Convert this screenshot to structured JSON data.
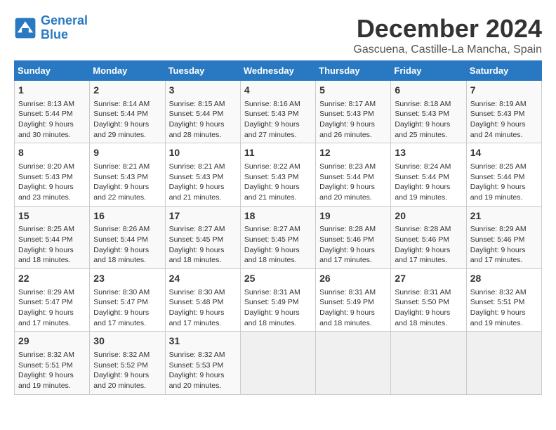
{
  "logo": {
    "line1": "General",
    "line2": "Blue"
  },
  "title": "December 2024",
  "subtitle": "Gascuena, Castille-La Mancha, Spain",
  "days_of_week": [
    "Sunday",
    "Monday",
    "Tuesday",
    "Wednesday",
    "Thursday",
    "Friday",
    "Saturday"
  ],
  "weeks": [
    [
      {
        "day": "1",
        "info": "Sunrise: 8:13 AM\nSunset: 5:44 PM\nDaylight: 9 hours and 30 minutes."
      },
      {
        "day": "2",
        "info": "Sunrise: 8:14 AM\nSunset: 5:44 PM\nDaylight: 9 hours and 29 minutes."
      },
      {
        "day": "3",
        "info": "Sunrise: 8:15 AM\nSunset: 5:44 PM\nDaylight: 9 hours and 28 minutes."
      },
      {
        "day": "4",
        "info": "Sunrise: 8:16 AM\nSunset: 5:43 PM\nDaylight: 9 hours and 27 minutes."
      },
      {
        "day": "5",
        "info": "Sunrise: 8:17 AM\nSunset: 5:43 PM\nDaylight: 9 hours and 26 minutes."
      },
      {
        "day": "6",
        "info": "Sunrise: 8:18 AM\nSunset: 5:43 PM\nDaylight: 9 hours and 25 minutes."
      },
      {
        "day": "7",
        "info": "Sunrise: 8:19 AM\nSunset: 5:43 PM\nDaylight: 9 hours and 24 minutes."
      }
    ],
    [
      {
        "day": "8",
        "info": "Sunrise: 8:20 AM\nSunset: 5:43 PM\nDaylight: 9 hours and 23 minutes."
      },
      {
        "day": "9",
        "info": "Sunrise: 8:21 AM\nSunset: 5:43 PM\nDaylight: 9 hours and 22 minutes."
      },
      {
        "day": "10",
        "info": "Sunrise: 8:21 AM\nSunset: 5:43 PM\nDaylight: 9 hours and 21 minutes."
      },
      {
        "day": "11",
        "info": "Sunrise: 8:22 AM\nSunset: 5:43 PM\nDaylight: 9 hours and 21 minutes."
      },
      {
        "day": "12",
        "info": "Sunrise: 8:23 AM\nSunset: 5:44 PM\nDaylight: 9 hours and 20 minutes."
      },
      {
        "day": "13",
        "info": "Sunrise: 8:24 AM\nSunset: 5:44 PM\nDaylight: 9 hours and 19 minutes."
      },
      {
        "day": "14",
        "info": "Sunrise: 8:25 AM\nSunset: 5:44 PM\nDaylight: 9 hours and 19 minutes."
      }
    ],
    [
      {
        "day": "15",
        "info": "Sunrise: 8:25 AM\nSunset: 5:44 PM\nDaylight: 9 hours and 18 minutes."
      },
      {
        "day": "16",
        "info": "Sunrise: 8:26 AM\nSunset: 5:44 PM\nDaylight: 9 hours and 18 minutes."
      },
      {
        "day": "17",
        "info": "Sunrise: 8:27 AM\nSunset: 5:45 PM\nDaylight: 9 hours and 18 minutes."
      },
      {
        "day": "18",
        "info": "Sunrise: 8:27 AM\nSunset: 5:45 PM\nDaylight: 9 hours and 18 minutes."
      },
      {
        "day": "19",
        "info": "Sunrise: 8:28 AM\nSunset: 5:46 PM\nDaylight: 9 hours and 17 minutes."
      },
      {
        "day": "20",
        "info": "Sunrise: 8:28 AM\nSunset: 5:46 PM\nDaylight: 9 hours and 17 minutes."
      },
      {
        "day": "21",
        "info": "Sunrise: 8:29 AM\nSunset: 5:46 PM\nDaylight: 9 hours and 17 minutes."
      }
    ],
    [
      {
        "day": "22",
        "info": "Sunrise: 8:29 AM\nSunset: 5:47 PM\nDaylight: 9 hours and 17 minutes."
      },
      {
        "day": "23",
        "info": "Sunrise: 8:30 AM\nSunset: 5:47 PM\nDaylight: 9 hours and 17 minutes."
      },
      {
        "day": "24",
        "info": "Sunrise: 8:30 AM\nSunset: 5:48 PM\nDaylight: 9 hours and 17 minutes."
      },
      {
        "day": "25",
        "info": "Sunrise: 8:31 AM\nSunset: 5:49 PM\nDaylight: 9 hours and 18 minutes."
      },
      {
        "day": "26",
        "info": "Sunrise: 8:31 AM\nSunset: 5:49 PM\nDaylight: 9 hours and 18 minutes."
      },
      {
        "day": "27",
        "info": "Sunrise: 8:31 AM\nSunset: 5:50 PM\nDaylight: 9 hours and 18 minutes."
      },
      {
        "day": "28",
        "info": "Sunrise: 8:32 AM\nSunset: 5:51 PM\nDaylight: 9 hours and 19 minutes."
      }
    ],
    [
      {
        "day": "29",
        "info": "Sunrise: 8:32 AM\nSunset: 5:51 PM\nDaylight: 9 hours and 19 minutes."
      },
      {
        "day": "30",
        "info": "Sunrise: 8:32 AM\nSunset: 5:52 PM\nDaylight: 9 hours and 20 minutes."
      },
      {
        "day": "31",
        "info": "Sunrise: 8:32 AM\nSunset: 5:53 PM\nDaylight: 9 hours and 20 minutes."
      },
      {
        "day": "",
        "info": ""
      },
      {
        "day": "",
        "info": ""
      },
      {
        "day": "",
        "info": ""
      },
      {
        "day": "",
        "info": ""
      }
    ]
  ]
}
